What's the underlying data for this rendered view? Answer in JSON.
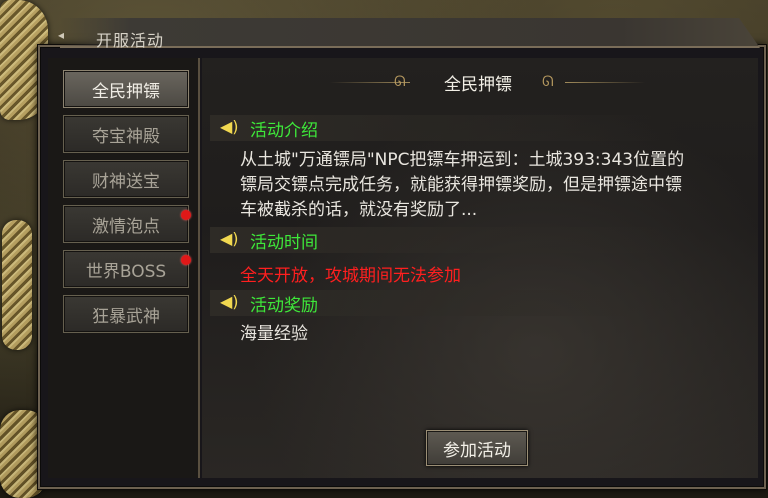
{
  "window": {
    "title": "开服活动"
  },
  "sidebar": {
    "items": [
      {
        "label": "全民押镖",
        "active": true,
        "dot": false
      },
      {
        "label": "夺宝神殿",
        "active": false,
        "dot": false
      },
      {
        "label": "财神送宝",
        "active": false,
        "dot": false
      },
      {
        "label": "激情泡点",
        "active": false,
        "dot": true
      },
      {
        "label": "世界BOSS",
        "active": false,
        "dot": true
      },
      {
        "label": "狂暴武神",
        "active": false,
        "dot": false
      }
    ]
  },
  "content": {
    "title": "全民押镖",
    "sections": [
      {
        "heading": "活动介绍",
        "lines": [
          "从土城\"万通镖局\"NPC把镖车押运到：土城393:343位置的",
          "镖局交镖点完成任务，就能获得押镖奖励，但是押镖途中镖",
          "车被截杀的话，就没有奖励了..."
        ]
      },
      {
        "heading": "活动时间",
        "warning": "全天开放，攻城期间无法参加"
      },
      {
        "heading": "活动奖励",
        "lines": [
          "海量经验"
        ]
      }
    ],
    "join_button": "参加活动"
  },
  "colors": {
    "section_heading": "#3ee83a",
    "warning": "#ff1f1f",
    "speaker": "#f1d850",
    "notification_dot": "#e01818"
  },
  "icons": {
    "section": "speaker-icon",
    "notification": "red-dot-badge"
  }
}
